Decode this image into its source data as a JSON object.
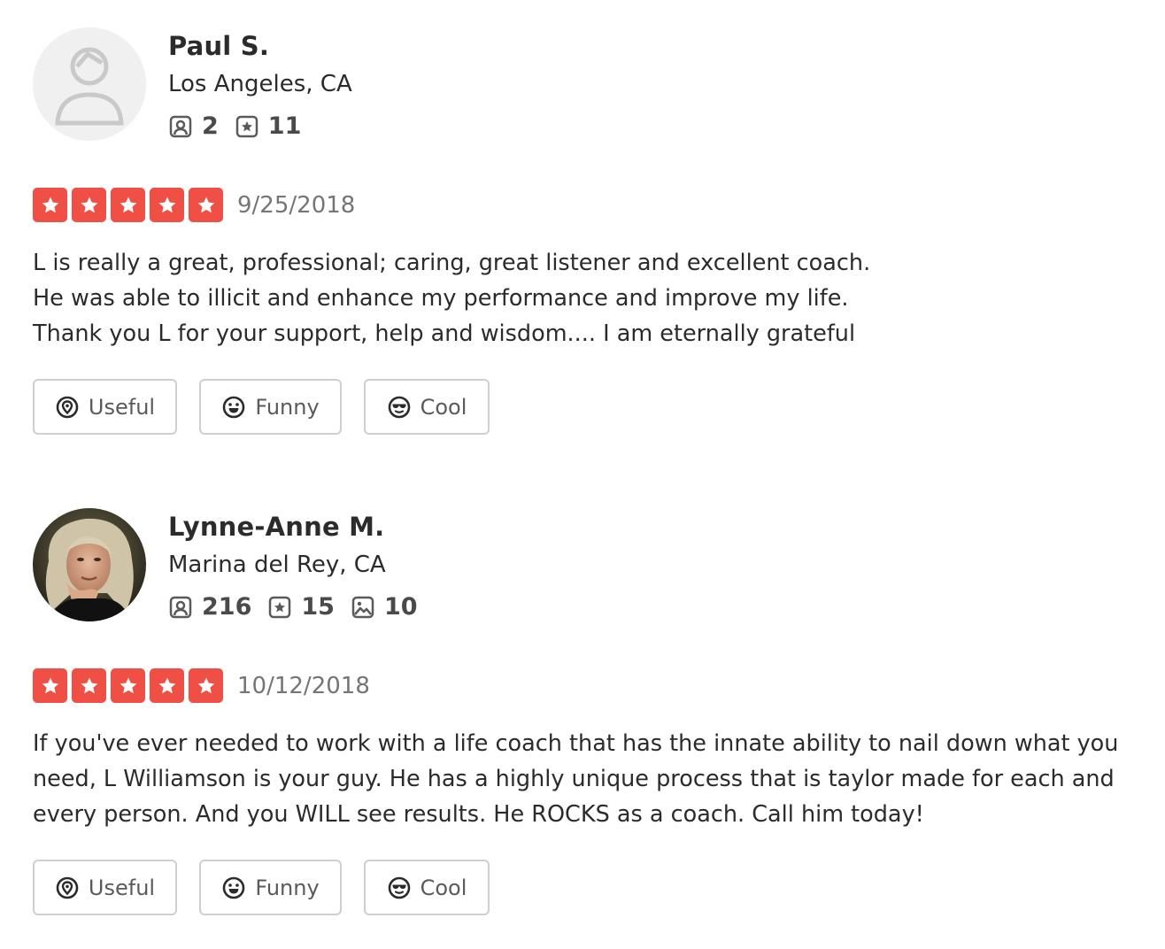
{
  "reviews": [
    {
      "user": {
        "name": "Paul S.",
        "location": "Los Angeles, CA",
        "avatar": "default-avatar-icon",
        "stats": [
          {
            "icon": "friends-icon",
            "value": "2"
          },
          {
            "icon": "reviews-icon",
            "value": "11"
          }
        ]
      },
      "rating": 5,
      "date": "9/25/2018",
      "text": "L is really a great, professional; caring, great listener and excellent coach.\nHe was able to illicit and enhance my performance and improve my life.\nThank you  L for your support, help and wisdom.... I am eternally grateful",
      "buttons": {
        "useful": "Useful",
        "funny": "Funny",
        "cool": "Cool"
      }
    },
    {
      "user": {
        "name": "Lynne-Anne M.",
        "location": "Marina del Rey, CA",
        "avatar": "user-photo",
        "stats": [
          {
            "icon": "friends-icon",
            "value": "216"
          },
          {
            "icon": "reviews-icon",
            "value": "15"
          },
          {
            "icon": "photos-icon",
            "value": "10"
          }
        ]
      },
      "rating": 5,
      "date": "10/12/2018",
      "text": "If you've ever needed to work with a life coach that has the innate ability to nail down what you need, L Williamson is your guy. He has a highly unique process that is taylor made for each and every person.  And you WILL see results. He ROCKS as a coach. Call him today!",
      "buttons": {
        "useful": "Useful",
        "funny": "Funny",
        "cool": "Cool"
      }
    }
  ],
  "colors": {
    "star_bg": "#ef4f44",
    "text": "#2b2b2b",
    "muted": "#757575",
    "border": "#cfcfcf"
  }
}
